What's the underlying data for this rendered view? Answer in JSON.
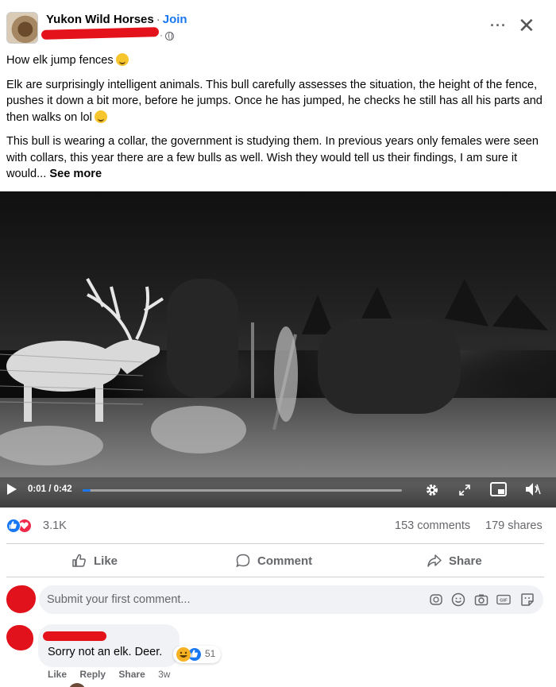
{
  "header": {
    "group_name": "Yukon Wild Horses",
    "separator": "·",
    "join_label": "Join",
    "meta_dot": "·"
  },
  "post": {
    "paragraphs": [
      "How elk jump fences",
      "Elk are surprisingly intelligent animals. This bull carefully assesses the situation, the height of the fence, pushes it down a bit more, before he jumps. Once he has jumped, he checks he still has all his parts and then walks on lol",
      "This bull is wearing a collar, the government is studying them. In previous years only females were seen with collars, this year there are a few bulls as well. Wish they would tell us their findings, I am sure it would..."
    ],
    "see_more": "See more"
  },
  "video": {
    "time": "0:01 / 0:42",
    "progress_fraction": 0.024
  },
  "stats": {
    "reaction_count": "3.1K",
    "comments": "153 comments",
    "shares": "179 shares"
  },
  "actions": {
    "like": "Like",
    "comment": "Comment",
    "share": "Share"
  },
  "comment_box": {
    "placeholder": "Submit your first comment..."
  },
  "comments": [
    {
      "text": "Sorry not an elk. Deer.",
      "reaction_count": "51",
      "like": "Like",
      "reply": "Reply",
      "share": "Share",
      "time": "3w"
    }
  ],
  "colors": {
    "accent": "#1877f2",
    "love": "#f02849",
    "redaction": "#e3121b",
    "muted": "#65676b"
  }
}
